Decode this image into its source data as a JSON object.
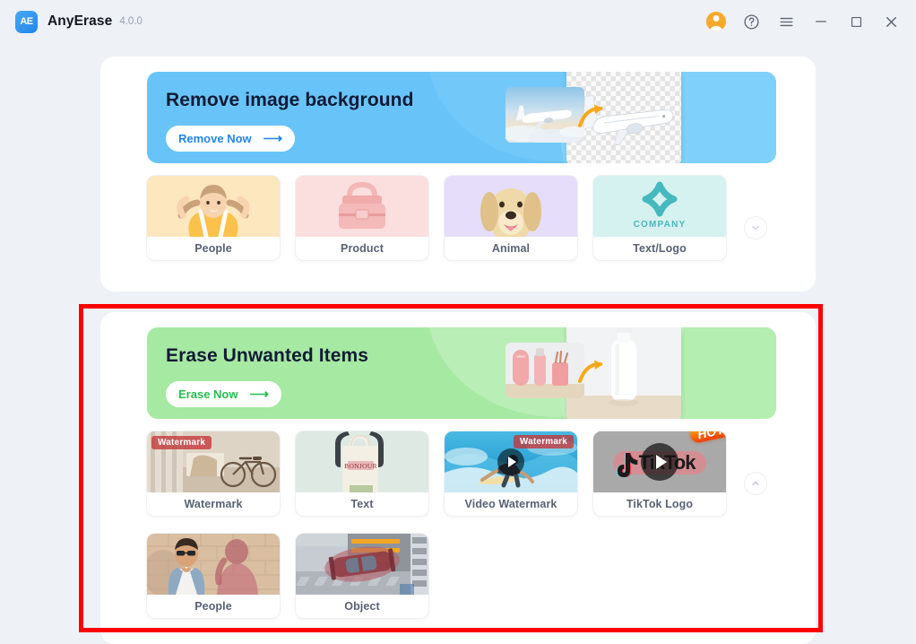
{
  "window": {
    "app_name": "AnyErase",
    "version": "4.0.0",
    "logo_text": "AE",
    "controls": {
      "account_icon": "user-avatar-icon",
      "help_icon": "help-circle-icon",
      "menu_icon": "hamburger-menu-icon",
      "minimize_icon": "minimize-icon",
      "maximize_icon": "maximize-icon",
      "close_icon": "close-icon"
    }
  },
  "colors": {
    "page_background": "#eef1f6",
    "card_background": "#ffffff",
    "banner_blue": "#68c4f8",
    "banner_green": "#a6e9a2",
    "cta_blue_text": "#1f86ea",
    "cta_green_text": "#23bf4e",
    "heading_text": "#111a36",
    "caption_text": "#596274",
    "highlight_border": "#ff0000",
    "accent_orange": "#f9a82c"
  },
  "sections": [
    {
      "id": "remove-background",
      "banner": {
        "title": "Remove image background",
        "cta_label": "Remove Now",
        "cta_arrow_icon": "arrow-right-icon",
        "theme": "blue",
        "preview_before": "airplane-photo-thumbnail",
        "preview_after": "airplane-cutout-transparent-thumbnail",
        "transform_arrow_icon": "curved-arrow-icon"
      },
      "tiles": [
        {
          "label": "People",
          "thumb": "girl-portrait-thumbnail",
          "badge": null
        },
        {
          "label": "Product",
          "thumb": "pink-handbag-thumbnail",
          "badge": null
        },
        {
          "label": "Animal",
          "thumb": "golden-retriever-dog-thumbnail",
          "badge": null
        },
        {
          "label": "Text/Logo",
          "thumb": "company-logo-thumbnail",
          "badge": null,
          "thumb_text": "COMPANY"
        }
      ],
      "expand_icon": "chevron-down-icon",
      "expanded": false
    },
    {
      "id": "erase-unwanted-items",
      "highlighted": true,
      "banner": {
        "title": "Erase Unwanted Items",
        "cta_label": "Erase Now",
        "cta_arrow_icon": "arrow-right-icon",
        "theme": "green",
        "preview_before": "pink-bottles-photo-thumbnail",
        "preview_after": "white-bottle-cleaned-thumbnail",
        "transform_arrow_icon": "curved-arrow-icon"
      },
      "tiles": [
        {
          "label": "Watermark",
          "thumb": "bicycle-room-thumbnail",
          "overlay_text": "Watermark",
          "badge": null,
          "has_play": false
        },
        {
          "label": "Text",
          "thumb": "bonjour-tote-bag-thumbnail",
          "overlay_text": "BONJOUR",
          "badge": null,
          "has_play": false
        },
        {
          "label": "Video Watermark",
          "thumb": "surfer-wave-thumbnail",
          "overlay_text": "Watermark",
          "badge": null,
          "has_play": true
        },
        {
          "label": "TikTok Logo",
          "thumb": "tiktok-logo-thumbnail",
          "overlay_text": "TikTok",
          "badge": "HOT!",
          "has_play": true
        },
        {
          "label": "People",
          "thumb": "man-sunglasses-wall-thumbnail",
          "overlay_text": null,
          "badge": null,
          "has_play": false
        },
        {
          "label": "Object",
          "thumb": "red-car-aerial-thumbnail",
          "overlay_text": null,
          "badge": null,
          "has_play": false
        }
      ],
      "collapse_icon": "chevron-up-icon",
      "expanded": true
    }
  ]
}
